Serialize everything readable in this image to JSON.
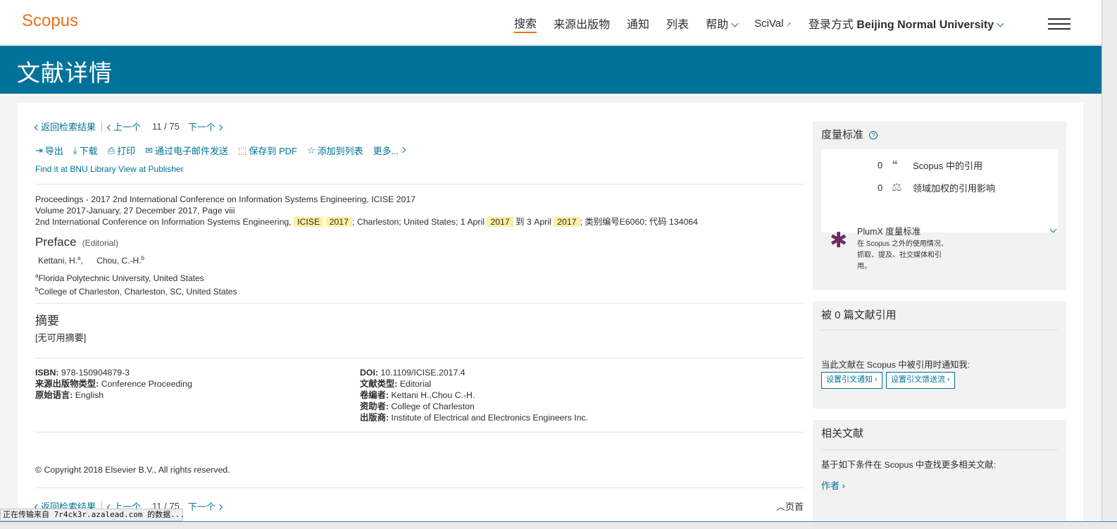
{
  "header": {
    "logo": "Scopus",
    "nav": [
      "搜索",
      "来源出版物",
      "通知",
      "列表",
      "帮助"
    ],
    "scival": "SciVal",
    "login_prefix": "登录方式",
    "login_org": "Beijing Normal University"
  },
  "banner": {
    "title": "文献详情"
  },
  "docnav": {
    "back": "返回检索结果",
    "prev": "上一个",
    "position": "11",
    "slash": "/",
    "total": "75",
    "next": "下一个"
  },
  "actions": [
    "导出",
    "下载",
    "打印",
    "通过电子邮件发送",
    "保存到 PDF",
    "添加到列表",
    "更多..."
  ],
  "links": [
    "Find it at BNU Library",
    "View at Publisher"
  ],
  "source": {
    "line1": "Proceedings - 2017 2nd International Conference on Information Systems Engineering, ICISE 2017",
    "line2": "Volume 2017-January, 27 December 2017, Page viii",
    "line3_a": "2nd International Conference on Information Systems Engineering, ",
    "hl1": "ICISE",
    "hl2": "2017",
    "line3_b": "; Charleston; United States; 1 April ",
    "hl3": "2017",
    "line3_c": " 到 3 April ",
    "hl4": "2017",
    "line3_d": "; 类别编号E6060; 代码 134064"
  },
  "title": "Preface",
  "doctype_tag": "(Editorial)",
  "authors": [
    {
      "name": "Kettani, H.",
      "sup": "a"
    },
    {
      "name": "Chou, C.-H.",
      "sup": "b"
    }
  ],
  "affiliations": [
    {
      "sup": "a",
      "text": "Florida Polytechnic University, United States"
    },
    {
      "sup": "b",
      "text": "College of Charleston, Charleston, SC, United States"
    }
  ],
  "abstract": {
    "heading": "摘要",
    "text": "[无可用摘要]"
  },
  "meta_left": [
    {
      "label": "ISBN:",
      "value": "978-150904879-3"
    },
    {
      "label": "来源出版物类型:",
      "value": "Conference Proceeding"
    },
    {
      "label": "原始语言:",
      "value": "English"
    }
  ],
  "meta_right": [
    {
      "label": "DOI:",
      "value": "10.1109/ICISE.2017.4"
    },
    {
      "label": "文献类型:",
      "value": "Editorial"
    },
    {
      "label": "卷编者:",
      "value": "Kettani H.,Chou C.-H."
    },
    {
      "label": "资助者:",
      "value": "College of Charleston"
    },
    {
      "label": "出版商:",
      "value": "Institute of Electrical and Electronics Engineers Inc."
    }
  ],
  "copyright": "Copyright 2018 Elsevier B.V., All rights reserved.",
  "top_page": "页首",
  "metrics_panel": {
    "title": "度量标准",
    "scopus_count": "0",
    "scopus_label": "Scopus 中的引用",
    "fwci_count": "0",
    "fwci_label": "领域加权的引用影响",
    "plumx_title": "PlumX 度量标准",
    "plumx_desc": "在 Scopus 之外的使用情况、抓取、提及、社交媒体和引用。"
  },
  "cited_panel": {
    "title": "被 0 篇文献引用",
    "notify": "当此文献在 Scopus 中被引用时通知我:",
    "btn1": "设置引文通知",
    "btn2": "设置引文馈送流"
  },
  "related_panel": {
    "title": "相关文献",
    "desc": "基于如下条件在 Scopus 中查找更多相关文献:",
    "link": "作者"
  },
  "status": "正在传输来自 7r4ck3r.azalead.com 的数据..."
}
